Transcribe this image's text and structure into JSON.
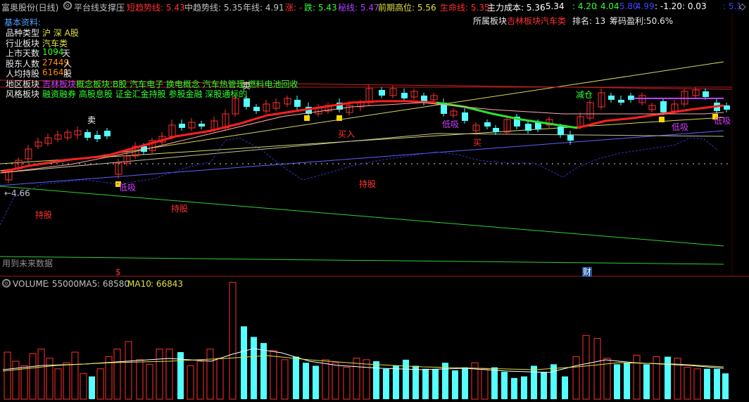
{
  "title": "富奥股份(日线)",
  "indicator_name": "平台线支撑压",
  "indicators": [
    {
      "label": "短趋势线",
      "value": ": 5.43",
      "color": "#ff3030"
    },
    {
      "label": "中趋势线",
      "value": ": 5.35",
      "color": "#c0c0c0"
    },
    {
      "label": "年线",
      "value": ": 4.91",
      "color": "#c0c0c0"
    },
    {
      "label": "涨",
      "value": ": -",
      "color": "#ff3030"
    },
    {
      "label": "跌",
      "value": ": 5.43",
      "color": "#30ff30"
    },
    {
      "label": "秘线",
      "value": ": 5.47",
      "color": "#b040ff"
    },
    {
      "label": "前期高位",
      "value": ": 5.56",
      "color": "#e0e040"
    },
    {
      "label": "生命线",
      "value": ": 5.35",
      "color": "#ff3030"
    },
    {
      "label": "主力成本",
      "value": ": 5.36",
      "color": "#ffffff"
    },
    {
      "label": "",
      "value": ": 5.34",
      "color": "#ffffff"
    },
    {
      "label": "",
      "value": ": 4.20",
      "color": "#30ff30"
    },
    {
      "label": "",
      "value": ": 4.04",
      "color": "#30ff30"
    },
    {
      "label": "",
      "value": ": 5.80",
      "color": "#4040ff"
    },
    {
      "label": "",
      "value": ": 4.99",
      "color": "#4040ff"
    },
    {
      "label": "",
      "value": ": -1.20",
      "color": "#ffffff"
    },
    {
      "label": "",
      "value": ": 0.03",
      "color": "#ffffff"
    },
    {
      "label": "",
      "value": ": 5.1",
      "color": "#4040ff"
    }
  ],
  "info_panel": {
    "heading": "基本资料:",
    "rows": [
      {
        "label": "品种类型",
        "value": "沪 深 A股",
        "color": "#e0e040"
      },
      {
        "label": "行业板块",
        "value": "汽车类",
        "color": "#e0e040"
      },
      {
        "label": "上市天数",
        "value": "1094",
        "suffix": "天",
        "color": "#30ff30"
      },
      {
        "label": "股东人数",
        "value": "27449",
        "suffix": "人",
        "color": "#ff8c00"
      },
      {
        "label": "人均持股",
        "value": "61641",
        "suffix": "股",
        "color": "#ff8c00"
      },
      {
        "label": "地区板块",
        "value": "吉林板块",
        "extra": "概念板块:B股 汽车电子 换电概念 汽车热管理 燃料电池回收",
        "color": "#c040ff"
      },
      {
        "label": "风格板块",
        "value": "融资融券 高股息股 证金汇金持股 参股金融 深股通标的",
        "color": "#30ff30"
      }
    ]
  },
  "sector_label": "所属板块",
  "sector_value": "吉林板块汽车类",
  "rank_text": "排名: 13",
  "profit_label": "筹码盈利",
  "profit_value": ":50.6%",
  "chart_annotations": {
    "sell1": "卖",
    "hold1": "持股",
    "hold2": "持股",
    "hold3": "持股",
    "lowbuy1": "低吸",
    "lowbuy2": "低吸",
    "lowbuy3": "低吸",
    "lowbuy4": "低吸",
    "buyin": "买入",
    "buy2": "买",
    "reduce": "减仓",
    "sell2": "卖",
    "price_low": "←4.66",
    "future_data": "用到未来数据",
    "marker_s": "$",
    "marker_cai": "财"
  },
  "volume_header": {
    "name": "VOLUME",
    "value": ": 55000",
    "ma5_label": "MA5",
    "ma5_value": ": 68580",
    "ma10_label": "MA10",
    "ma10_value": ": 66843"
  },
  "colors": {
    "up": "#ff3030",
    "down": "#54ffff",
    "volume_up": "#ff3030",
    "volume_down": "#54ffff"
  }
}
